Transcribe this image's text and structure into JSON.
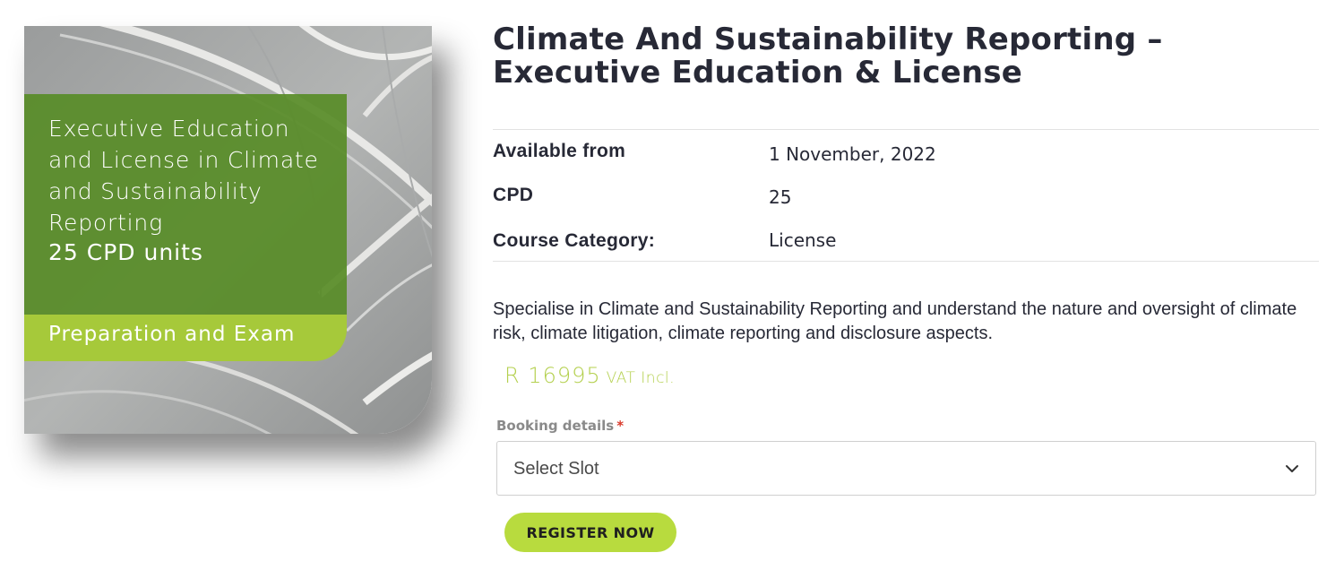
{
  "image": {
    "panel_lines": [
      "Executive Education",
      "and License in Climate",
      "and Sustainability",
      "Reporting"
    ],
    "cpd_units": "25 CPD units",
    "subtitle": "Preparation and Exam",
    "colors": {
      "panel_green": "#588c28",
      "bar_lime": "#a6c93a"
    }
  },
  "product": {
    "title": "Climate And Sustainability Reporting – Executive Education & License",
    "meta": [
      {
        "label": "Available from",
        "value": "1 November, 2022"
      },
      {
        "label": "CPD",
        "value": "25"
      },
      {
        "label": "Course Category:",
        "value": "License"
      }
    ],
    "description": "Specialise in Climate and Sustainability Reporting and understand the nature and oversight of climate risk, climate litigation, climate reporting and disclosure aspects.",
    "price": {
      "amount": "R 16995",
      "vat": "VAT Incl.",
      "color": "#b4d04e"
    }
  },
  "booking": {
    "label": "Booking details",
    "required_mark": "*",
    "selected": "Select Slot",
    "chevron_icon": "chevron-down-icon"
  },
  "actions": {
    "register_label": "REGISTER NOW",
    "register_color": "#b8db3e"
  }
}
